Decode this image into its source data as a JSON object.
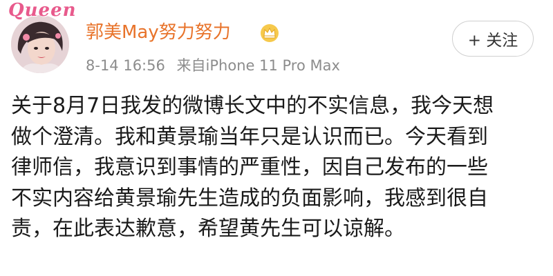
{
  "post": {
    "avatar": {
      "watermark": "Queen"
    },
    "user_name": "郭美May努力努力",
    "verified_badge": "crown-icon",
    "time": "8-14 16:56",
    "source": "来自iPhone 11 Pro Max",
    "follow_label": "+ 关注",
    "content_lines": [
      "关于8月7日我发的微博长文中的不实信息，我今天想",
      "做个澄清。我和黄景瑜当年只是认识而已。今天看到",
      "律师信，我意识到事情的严重性，因自己发布的一些",
      "不实内容给黄景瑜先生造成的负面影响，我感到很自",
      "责，在此表达歉意，希望黄先生可以谅解。"
    ]
  },
  "colors": {
    "user_name": "#e8732a",
    "meta": "#8c8c8c",
    "text": "#1a1a1a",
    "watermark": "#e85a8c"
  }
}
